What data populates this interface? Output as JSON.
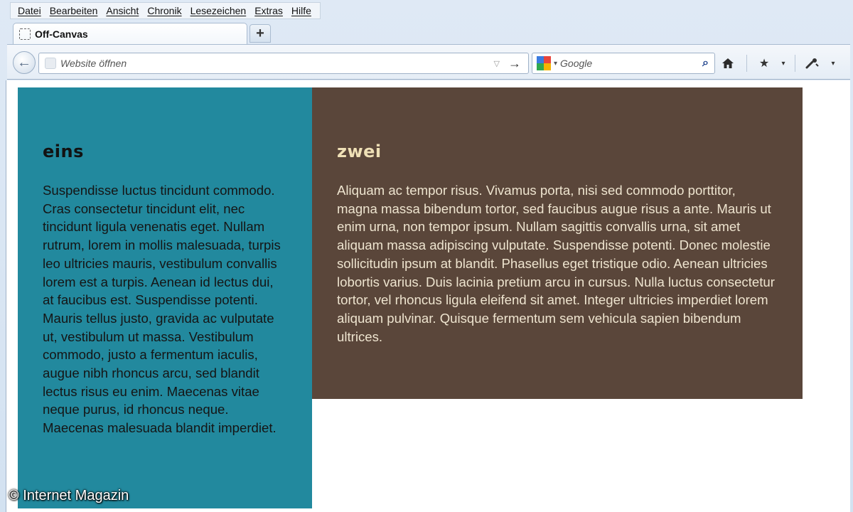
{
  "menu": {
    "items": [
      {
        "label": "Datei"
      },
      {
        "label": "Bearbeiten"
      },
      {
        "label": "Ansicht"
      },
      {
        "label": "Chronik"
      },
      {
        "label": "Lesezeichen"
      },
      {
        "label": "Extras"
      },
      {
        "label": "Hilfe"
      }
    ]
  },
  "tabs": {
    "active_title": "Off-Canvas",
    "new_tab_label": "+"
  },
  "navbar": {
    "back_icon": "back-arrow-icon",
    "url_placeholder": "Website öffnen",
    "url_value": "",
    "search_placeholder": "Google",
    "search_engine_icon": "google-icon",
    "home_icon": "home-icon",
    "bookmarks_icon": "bookmark-star-icon",
    "tools_icon": "tools-icon"
  },
  "page": {
    "panel_eins": {
      "heading": "eins",
      "text": "Suspendisse luctus tincidunt commodo. Cras consectetur tincidunt elit, nec tincidunt ligula venenatis eget. Nullam rutrum, lorem in mollis malesuada, turpis leo ultricies mauris, vestibulum convallis lorem est a turpis. Aenean id lectus dui, at faucibus est. Suspendisse potenti. Mauris tellus justo, gravida ac vulputate ut, vestibulum ut massa. Vestibulum commodo, justo a fermentum iaculis, augue nibh rhoncus arcu, sed blandit lectus risus eu enim. Maecenas vitae neque purus, id rhoncus neque. Maecenas malesuada blandit imperdiet.",
      "background": "#22899e"
    },
    "panel_zwei": {
      "heading": "zwei",
      "text": "Aliquam ac tempor risus. Vivamus porta, nisi sed commodo porttitor, magna massa bibendum tortor, sed faucibus augue risus a ante. Mauris ut enim urna, non tempor ipsum. Nullam sagittis convallis urna, sit amet aliquam massa adipiscing vulputate. Suspendisse potenti. Donec molestie sollicitudin ipsum at blandit. Phasellus eget tristique odio. Aenean ultricies lobortis varius. Duis lacinia pretium arcu in cursus. Nulla luctus consectetur tortor, vel rhoncus ligula eleifend sit amet. Integer ultricies imperdiet lorem aliquam pulvinar. Quisque fermentum sem vehicula sapien bibendum ultrices.",
      "background": "#5a463a"
    }
  },
  "watermark": "© Internet Magazin"
}
